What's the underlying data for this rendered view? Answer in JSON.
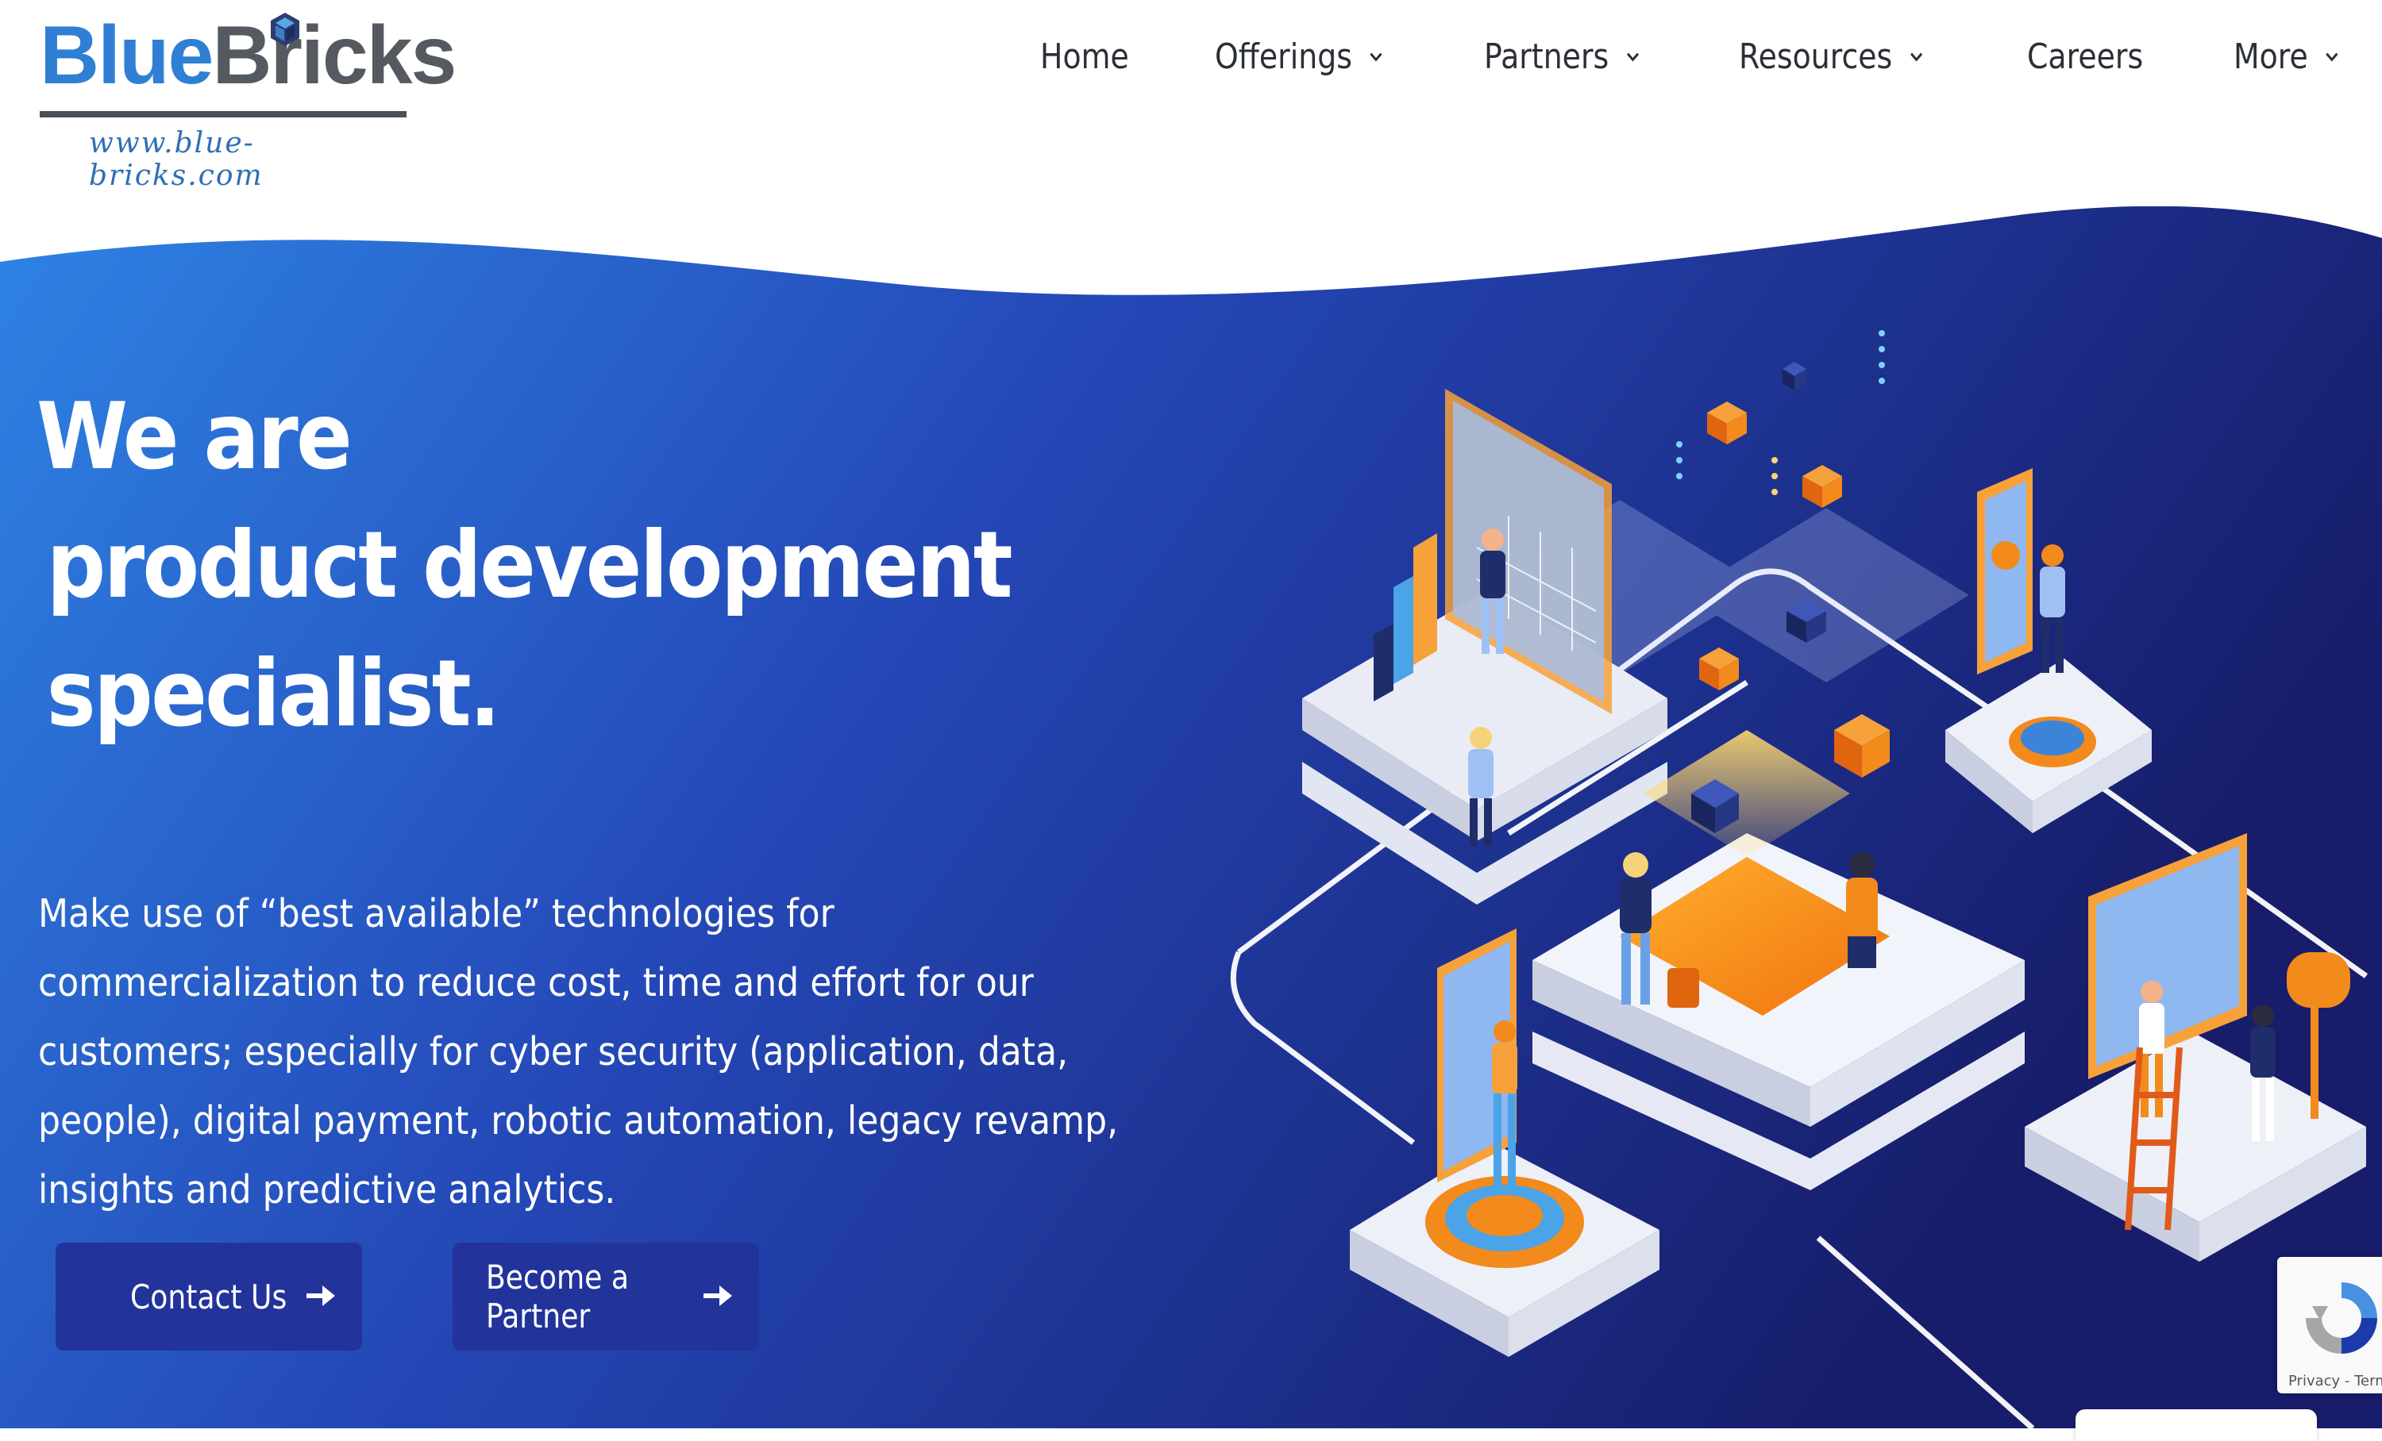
{
  "brand": {
    "name_part1": "Blue",
    "name_part2": "Bricks",
    "url": "www.blue-bricks.com",
    "primary_color": "#2f7fd4",
    "dark_color": "#555a60"
  },
  "nav": {
    "items": [
      {
        "label": "Home",
        "has_dropdown": false
      },
      {
        "label": "Offerings",
        "has_dropdown": true
      },
      {
        "label": "Partners",
        "has_dropdown": true
      },
      {
        "label": "Resources",
        "has_dropdown": true
      },
      {
        "label": "Careers",
        "has_dropdown": false
      },
      {
        "label": "More",
        "has_dropdown": true
      }
    ]
  },
  "hero": {
    "headline_line1": "We are",
    "headline_line2": "product development",
    "headline_line3": "specialist.",
    "description": "Make use of “best available” technologies for commercialization to reduce cost, time and effort for our customers; especially for cyber security (application, data, people), digital payment, robotic automation, legacy revamp, insights and predictive analytics.",
    "gradient_start": "#2d7fe0",
    "gradient_end": "#181f6e",
    "cta_contact": "Contact Us",
    "cta_partner": "Become a Partner",
    "button_color": "#22349a"
  },
  "recaptcha": {
    "footer_text": "Privacy - Terms"
  }
}
